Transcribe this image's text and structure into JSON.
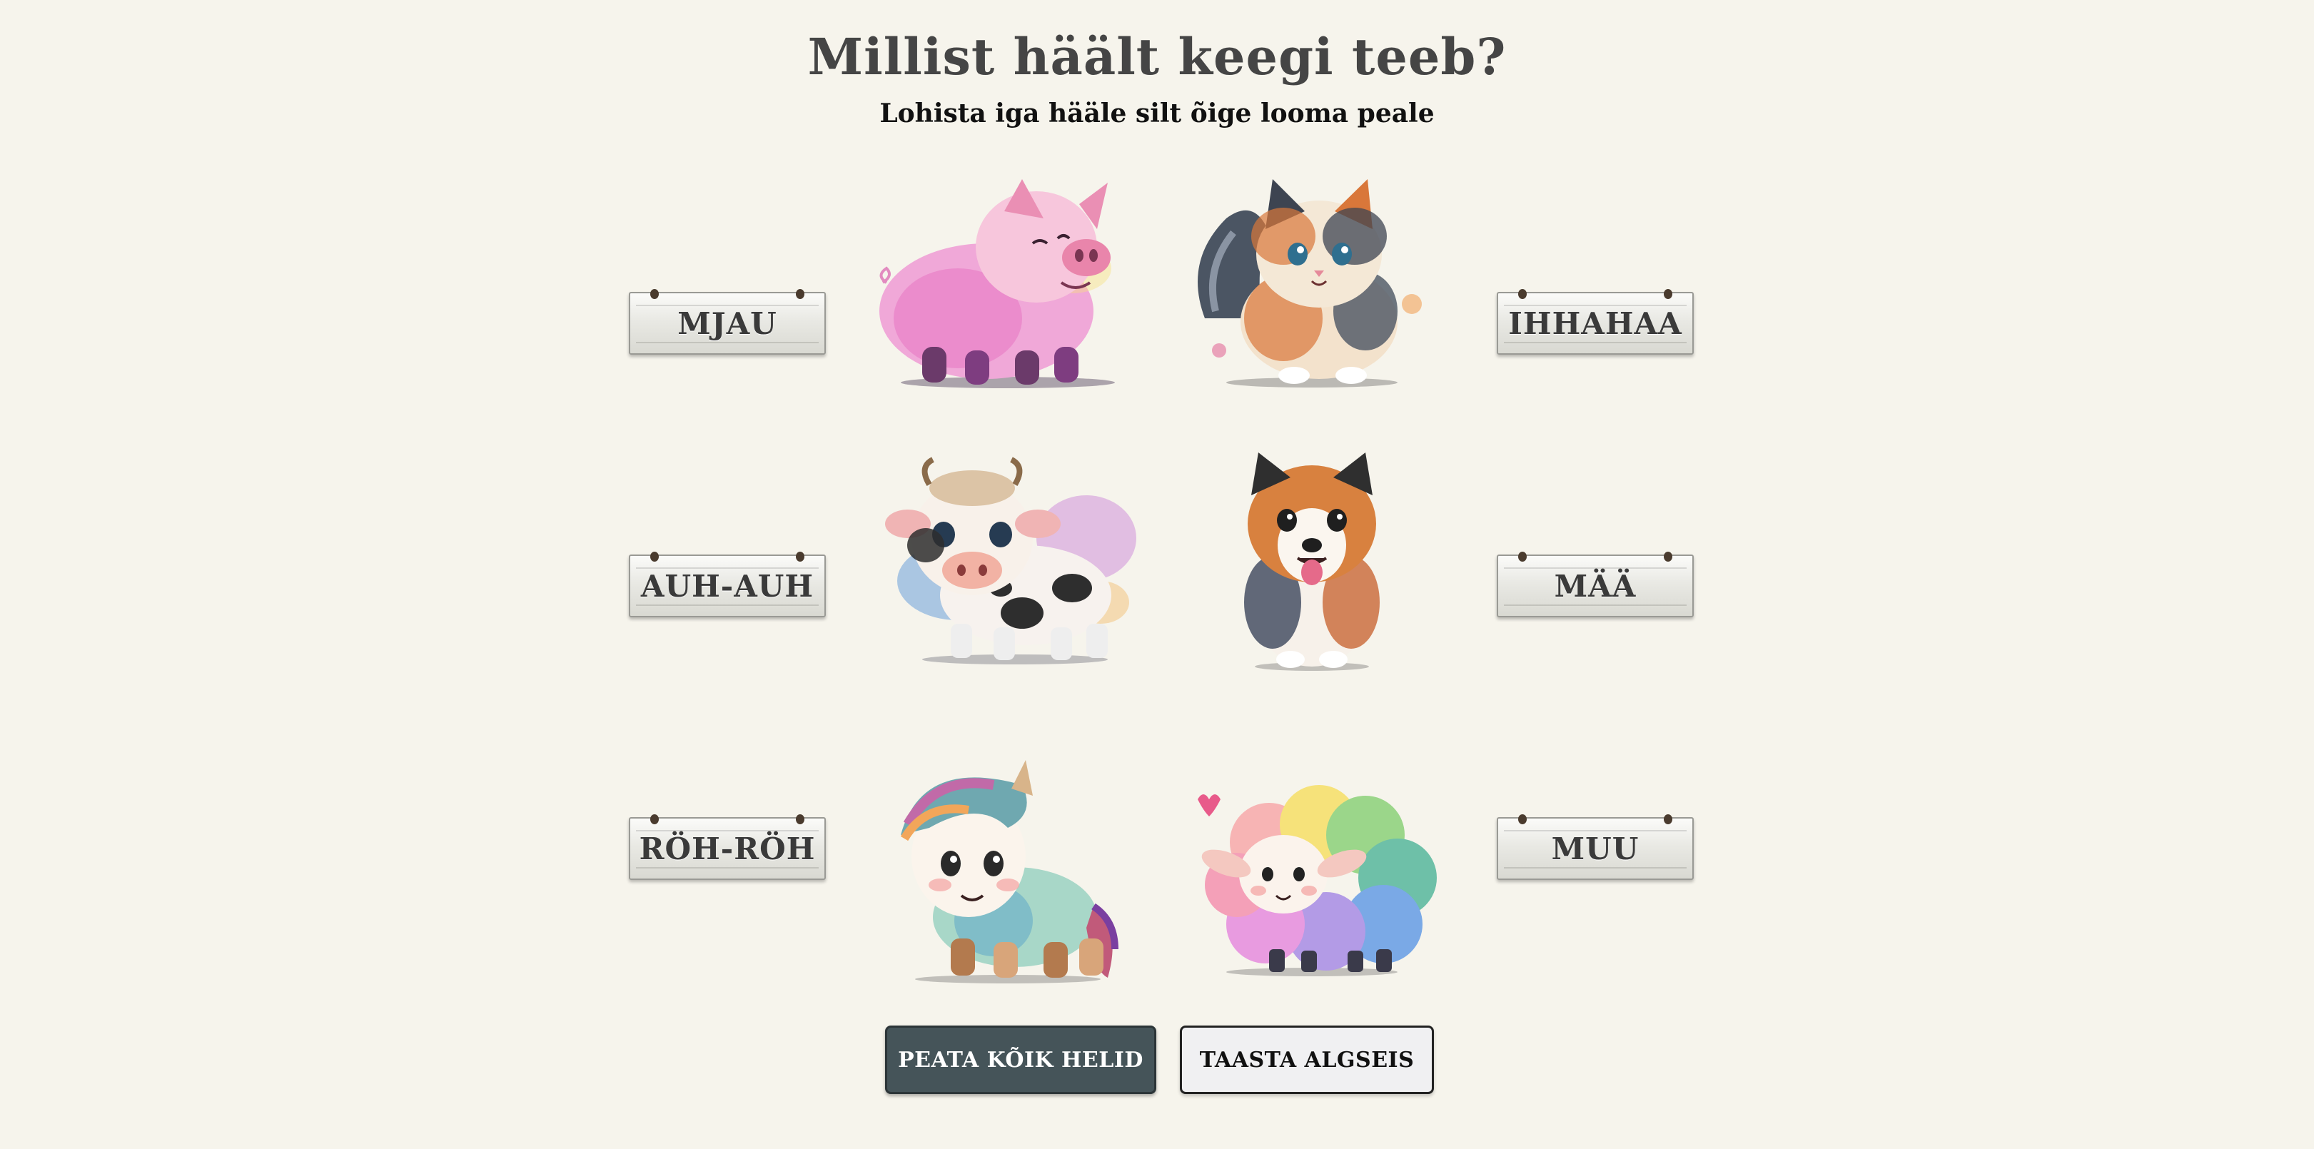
{
  "header": {
    "title": "Millist häält keegi teeb?",
    "subtitle": "Lohista iga hääle silt õige looma peale"
  },
  "sound_labels": {
    "left": [
      "MJAU",
      "AUH-AUH",
      "RÖH-RÖH"
    ],
    "right": [
      "IHHAHAA",
      "MÄÄ",
      "MUU"
    ]
  },
  "animals": [
    "pig",
    "cat",
    "cow",
    "dog",
    "horse",
    "sheep"
  ],
  "buttons": {
    "stop": "PEATA KÕIK HELID",
    "reset": "TAASTA ALGSEIS"
  },
  "colors": {
    "background": "#f6f4ec",
    "title": "#454545",
    "stop_button": "#455459"
  }
}
